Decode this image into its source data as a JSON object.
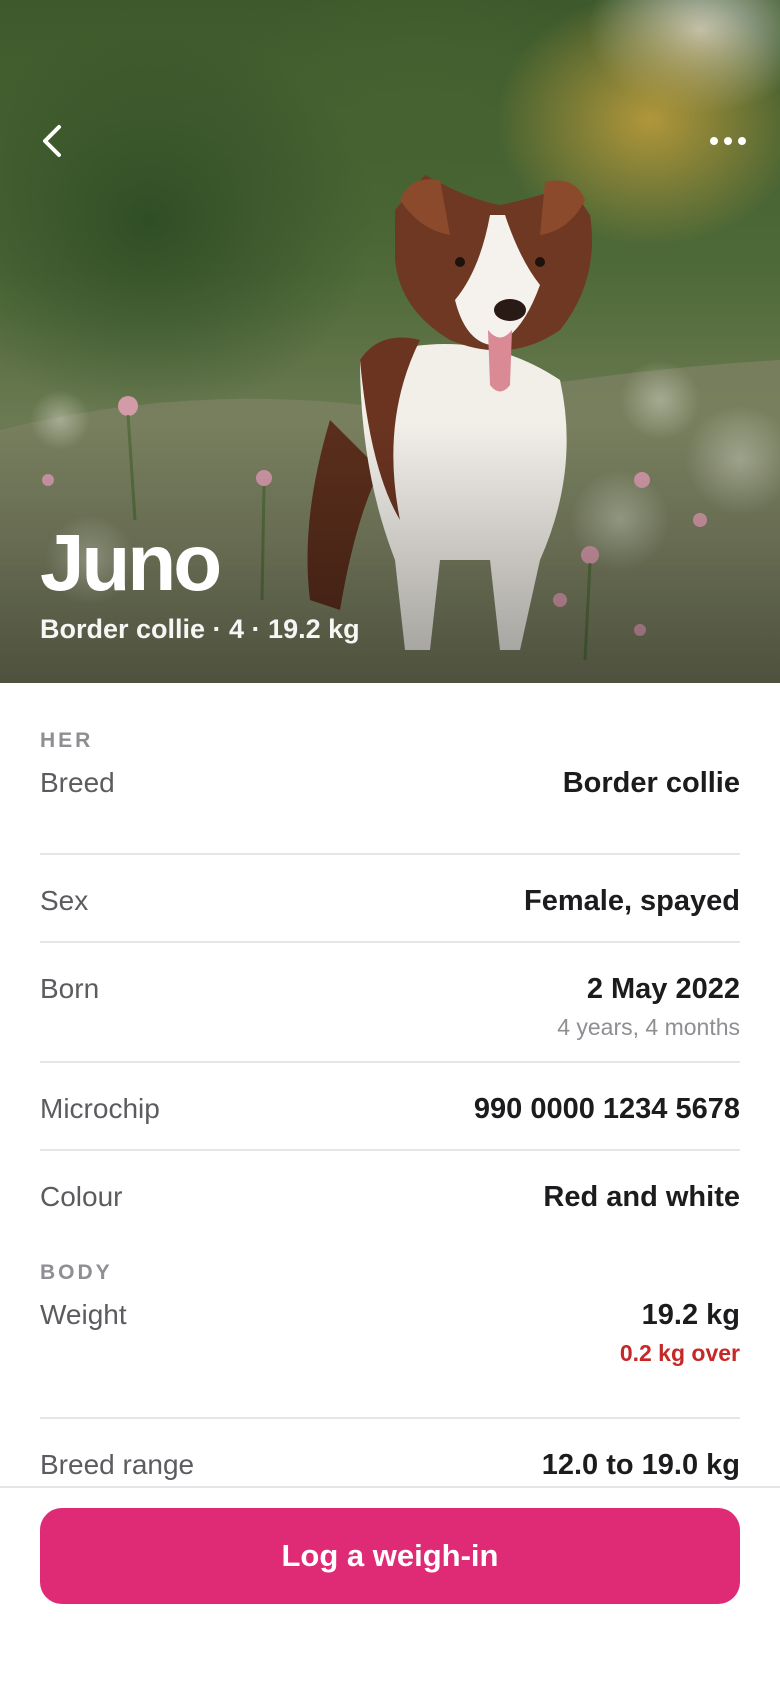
{
  "colors": {
    "accent": "#df2a76",
    "warning": "#c62828"
  },
  "header": {
    "back_icon": "chevron-left-icon",
    "more_icon": "more-horizontal-icon"
  },
  "pet": {
    "name": "Juno",
    "summary": "Border collie · 4 · 19.2 kg",
    "photo": "border-collie-photo"
  },
  "sections": {
    "her": {
      "title": "HER",
      "rows": {
        "breed": {
          "label": "Breed",
          "value": "Border collie"
        },
        "sex": {
          "label": "Sex",
          "value": "Female, spayed"
        },
        "born": {
          "label": "Born",
          "value": "2 May 2022",
          "note": "4 years, 4 months"
        },
        "microchip": {
          "label": "Microchip",
          "value": "990 0000 1234 5678"
        },
        "colour": {
          "label": "Colour",
          "value": "Red and white"
        }
      }
    },
    "body": {
      "title": "BODY",
      "rows": {
        "weight": {
          "label": "Weight",
          "value": "19.2 kg",
          "note": "0.2 kg over"
        },
        "breed_range": {
          "label": "Breed range",
          "value": "12.0 to 19.0 kg"
        }
      }
    }
  },
  "actions": {
    "log_weigh_in": "Log a weigh-in"
  }
}
